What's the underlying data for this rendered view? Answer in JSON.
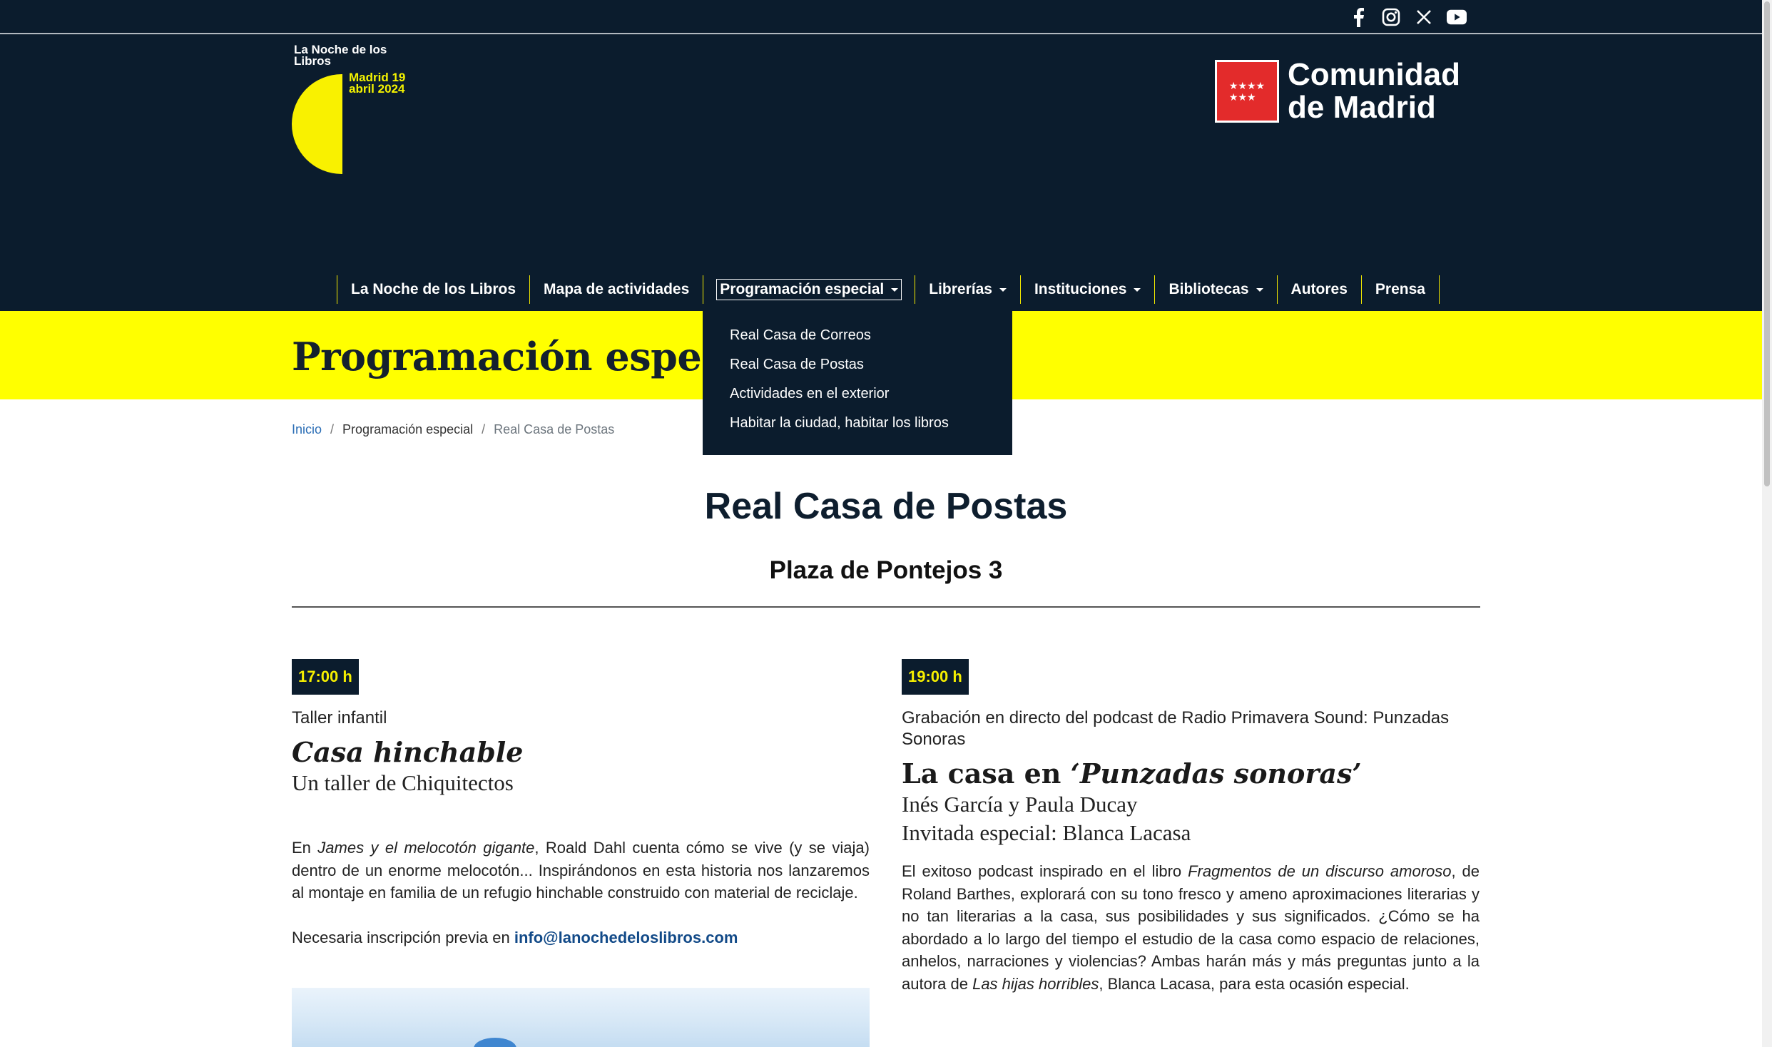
{
  "social": {
    "icons": [
      "facebook-icon",
      "instagram-icon",
      "x-icon",
      "youtube-icon"
    ]
  },
  "logo": {
    "line1": "La Noche de los Libros",
    "line2": "Madrid 19 abril 2024"
  },
  "cm": {
    "name_line1": "Comunidad",
    "name_line2": "de Madrid"
  },
  "nav": {
    "items": [
      {
        "label": "La Noche de los Libros"
      },
      {
        "label": "Mapa de actividades"
      },
      {
        "label": "Programación especial"
      },
      {
        "label": "Librerías"
      },
      {
        "label": "Instituciones"
      },
      {
        "label": "Bibliotecas"
      },
      {
        "label": "Autores"
      },
      {
        "label": "Prensa"
      }
    ],
    "dropdown": [
      "Real Casa de Correos",
      "Real Casa de Postas",
      "Actividades en el exterior",
      "Habitar la ciudad, habitar los libros"
    ]
  },
  "band": {
    "title": "Programación especial"
  },
  "breadcrumb": {
    "home": "Inicio",
    "section": "Programación especial",
    "current": "Real Casa de Postas",
    "sep": "/"
  },
  "page": {
    "title": "Real Casa de Postas",
    "address": "Plaza de Pontejos 3"
  },
  "events": {
    "left": {
      "time": "17:00 h",
      "category": "Taller infantil",
      "title": "Casa hinchable",
      "subtitle": "Un taller de Chiquitectos",
      "p1_a": "En ",
      "p1_italic": "James y el melocotón gigante",
      "p1_b": ", Roald Dahl cuenta cómo se vive (y se viaja) dentro de un enorme melocotón... Inspirándonos en esta historia nos lanzaremos al montaje en familia de un refugio hinchable construido con material de reciclaje.",
      "p2": "Necesaria inscripción previa en ",
      "email": "info@lanochedeloslibros.com"
    },
    "right": {
      "time": "19:00 h",
      "category": "Grabación en directo del podcast de Radio Primavera Sound: Punzadas Sonoras",
      "title_a": "La casa en ",
      "title_italic": "‘Punzadas sonoras’",
      "subtitle1": "Inés García y Paula Ducay",
      "subtitle2": "Invitada especial: Blanca Lacasa",
      "p1_a": "El exitoso podcast inspirado en el libro ",
      "p1_italic": "Fragmentos de un discurso amoroso",
      "p1_b": ", de Roland Barthes, explorará con su tono fresco y ameno aproximaciones literarias y no tan literarias a la casa, sus posibilidades y sus significados. ¿Cómo se ha abordado a lo largo del tiempo el estudio de la casa como espacio de relaciones, anhelos, narraciones y violencias? Ambas harán más y más preguntas junto a la autora de ",
      "p1_italic2": "Las hijas horribles",
      "p1_c": ", Blanca Lacasa, para esta ocasión especial."
    }
  },
  "colors": {
    "navy": "#0b1c2d",
    "yellow": "#ffff00",
    "red": "#e32b2b",
    "link": "#124a88"
  }
}
